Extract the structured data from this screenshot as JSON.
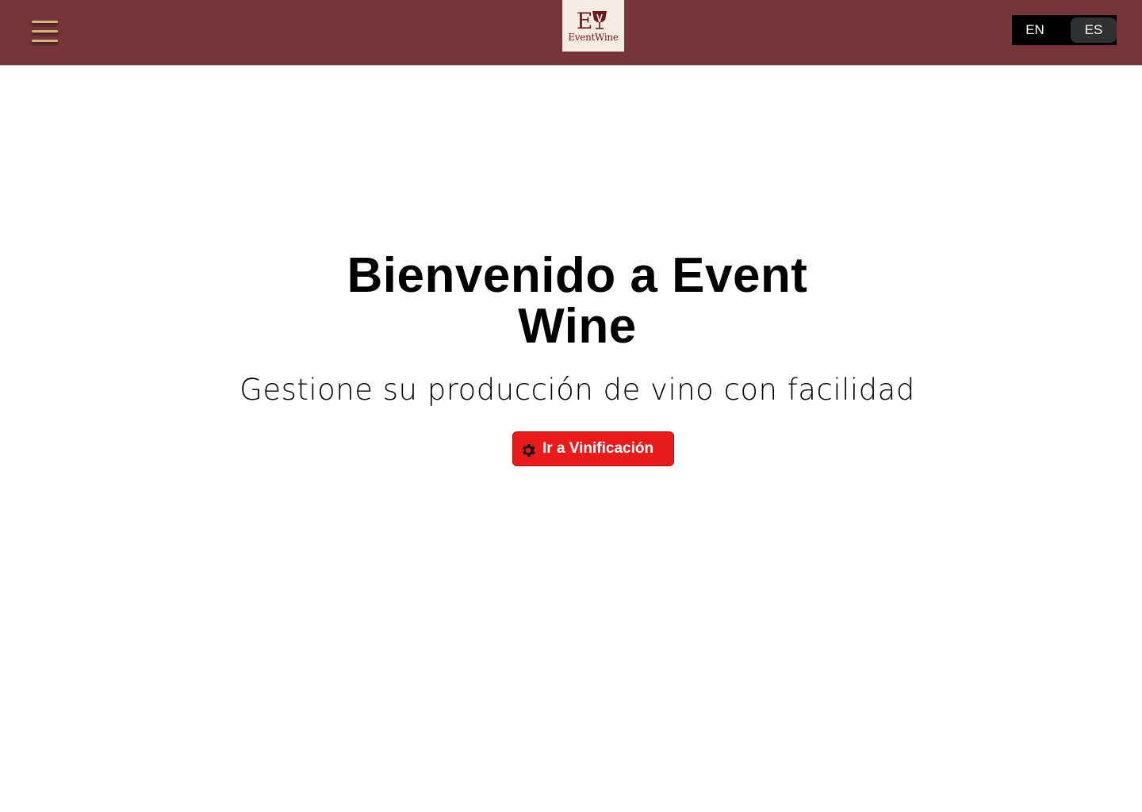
{
  "header": {
    "menu_icon": "hamburger-menu-icon",
    "logo": {
      "monogram": "EW",
      "text": "EventWine"
    },
    "language_switch": {
      "options": [
        "EN",
        "ES"
      ],
      "selected": "ES"
    },
    "colors": {
      "bar_background": "#763538",
      "menu_icon": "#d6b57c",
      "logo_background": "#f6ebe2"
    }
  },
  "hero": {
    "title": "Bienvenido a Event Wine",
    "subtitle": "Gestione su producción de vino con facilidad",
    "cta": {
      "label": "Ir a Vinificación",
      "icon": "gear-icon",
      "color": "#e91b1d"
    }
  }
}
